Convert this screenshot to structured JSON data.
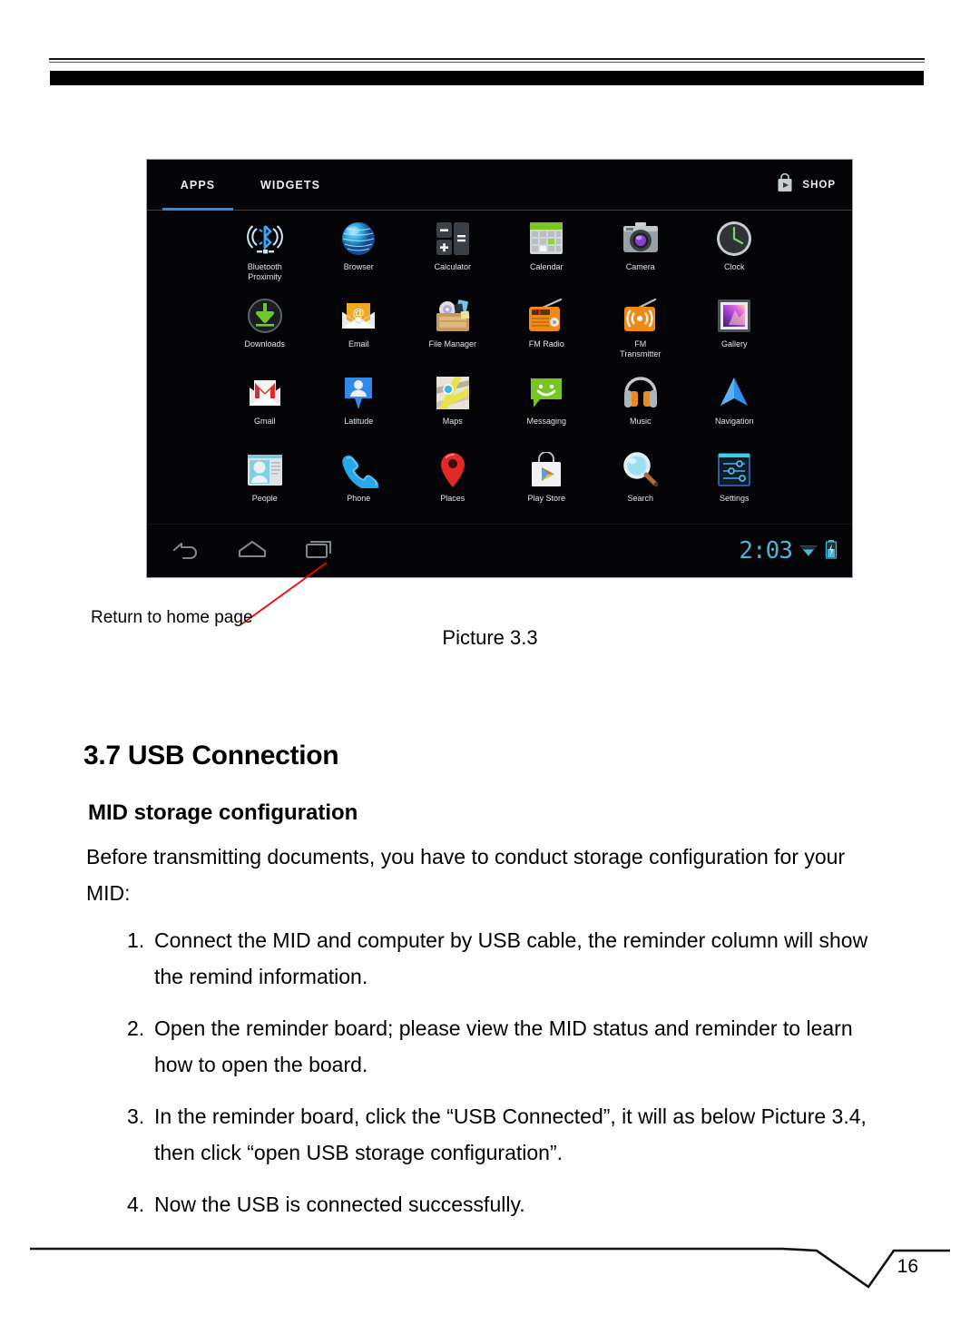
{
  "page": {
    "number": "16"
  },
  "figure": {
    "caption": "Picture 3.3",
    "callout_label": "Return to home page",
    "launcher": {
      "tabs": [
        {
          "label": "APPS",
          "active": true
        },
        {
          "label": "WIDGETS",
          "active": false
        }
      ],
      "shop": {
        "label": "SHOP",
        "icon": "shopping-bag-play-icon"
      },
      "apps": [
        {
          "label": "Bluetooth\nProximity",
          "icon": "bluetooth-proximity-icon"
        },
        {
          "label": "Browser",
          "icon": "browser-globe-icon"
        },
        {
          "label": "Calculator",
          "icon": "calculator-icon"
        },
        {
          "label": "Calendar",
          "icon": "calendar-icon"
        },
        {
          "label": "Camera",
          "icon": "camera-icon"
        },
        {
          "label": "Clock",
          "icon": "clock-icon"
        },
        {
          "label": "Downloads",
          "icon": "downloads-icon"
        },
        {
          "label": "Email",
          "icon": "email-envelope-icon"
        },
        {
          "label": "File Manager",
          "icon": "file-manager-icon"
        },
        {
          "label": "FM Radio",
          "icon": "fm-radio-icon"
        },
        {
          "label": "FM\nTransmitter",
          "icon": "fm-transmitter-icon"
        },
        {
          "label": "Gallery",
          "icon": "gallery-icon"
        },
        {
          "label": "Gmail",
          "icon": "gmail-icon"
        },
        {
          "label": "Latitude",
          "icon": "latitude-icon"
        },
        {
          "label": "Maps",
          "icon": "maps-icon"
        },
        {
          "label": "Messaging",
          "icon": "messaging-icon"
        },
        {
          "label": "Music",
          "icon": "music-headphones-icon"
        },
        {
          "label": "Navigation",
          "icon": "navigation-arrow-icon"
        },
        {
          "label": "People",
          "icon": "people-icon"
        },
        {
          "label": "Phone",
          "icon": "phone-handset-icon"
        },
        {
          "label": "Places",
          "icon": "places-pin-icon"
        },
        {
          "label": "Play Store",
          "icon": "play-store-icon"
        },
        {
          "label": "Search",
          "icon": "search-magnifier-icon"
        },
        {
          "label": "Settings",
          "icon": "settings-sliders-icon"
        }
      ],
      "navigation": [
        {
          "name": "back-icon"
        },
        {
          "name": "home-icon"
        },
        {
          "name": "recent-apps-icon"
        }
      ],
      "status": {
        "time": "2:03",
        "wifi_icon": "wifi-icon",
        "battery_icon": "battery-charging-icon"
      }
    },
    "accent_color": "#2f8cdd",
    "callout_color": "#ff0000"
  },
  "content": {
    "section_title": "3.7 USB Connection",
    "sub_title": "MID storage configuration",
    "paragraph": "Before transmitting documents, you have to conduct storage configuration for your MID:",
    "steps": [
      {
        "num": "1.",
        "text": "Connect the MID and computer by USB cable, the reminder column will show the remind information."
      },
      {
        "num": "2.",
        "text": "Open the reminder board; please view the MID status and reminder to learn how to open the board."
      },
      {
        "num": "3.",
        "text": "In the reminder board, click the “USB Connected”, it will as below Picture 3.4, then click “open USB storage configuration”."
      },
      {
        "num": "4.",
        "text": "Now the USB is connected successfully."
      }
    ]
  }
}
